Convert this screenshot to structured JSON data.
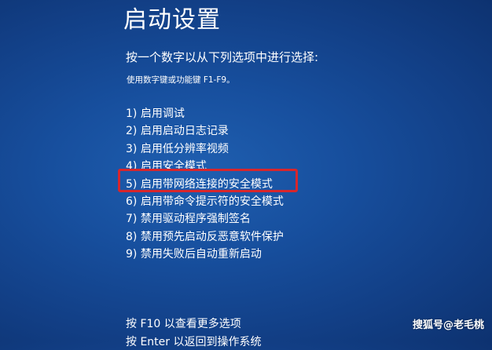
{
  "title": "启动设置",
  "prompt": "按一个数字以从下列选项中进行选择:",
  "hint": "使用数字键或功能键 F1-F9。",
  "options": [
    {
      "label": "1) 启用调试"
    },
    {
      "label": "2) 启用启动日志记录"
    },
    {
      "label": "3) 启用低分辨率视频"
    },
    {
      "label": "4) 启用安全模式"
    },
    {
      "label": "5) 启用带网络连接的安全模式"
    },
    {
      "label": "6) 启用带命令提示符的安全模式"
    },
    {
      "label": "7) 禁用驱动程序强制签名"
    },
    {
      "label": "8) 禁用预先启动反恶意软件保护"
    },
    {
      "label": "9) 禁用失败后自动重新启动"
    }
  ],
  "footer": {
    "line1": "按 F10 以查看更多选项",
    "line2": "按 Enter 以返回到操作系统"
  },
  "watermark": "搜狐号@老毛桃",
  "colors": {
    "background": "#174f9e",
    "text": "#ffffff",
    "highlight": "#d7262c"
  }
}
